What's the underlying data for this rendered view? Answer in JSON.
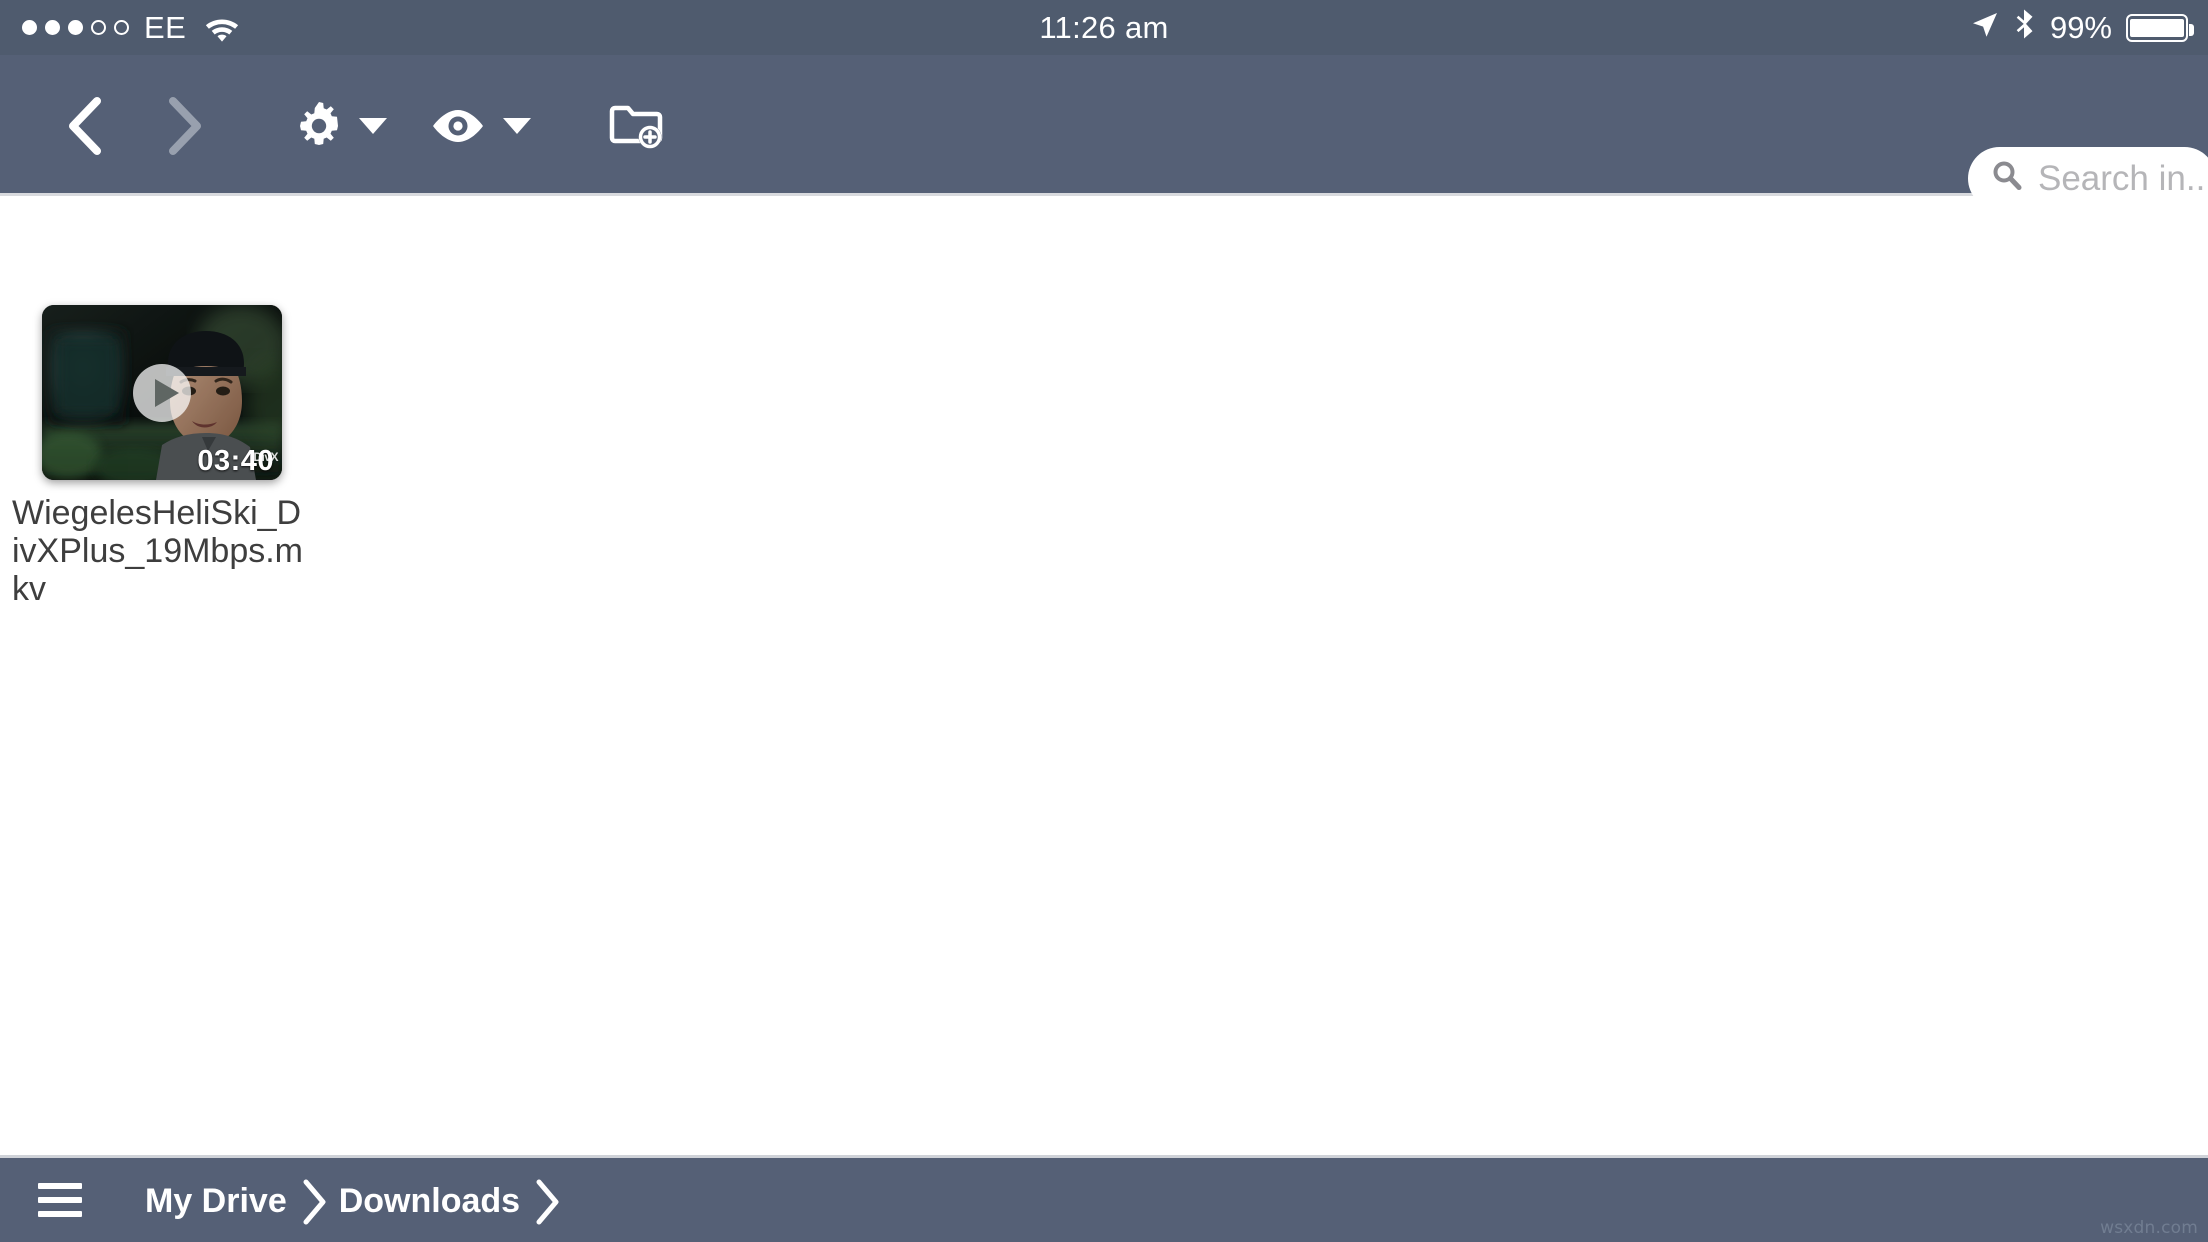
{
  "status_bar": {
    "signal_dots_filled": 3,
    "signal_dots_total": 5,
    "carrier": "EE",
    "wifi_icon": "wifi-icon",
    "time": "11:26 am",
    "location_icon": "location-arrow-icon",
    "bluetooth_icon": "bluetooth-icon",
    "battery_percent": "99%",
    "battery_level": 99
  },
  "toolbar": {
    "back_label": "‹",
    "forward_label": "›",
    "back_enabled": true,
    "forward_enabled": false,
    "settings_icon": "gear-icon",
    "view_icon": "eye-icon",
    "new_folder_icon": "new-folder-icon",
    "search": {
      "value": "",
      "placeholder": "Search in...",
      "icon": "search-icon"
    }
  },
  "content": {
    "files": [
      {
        "name": "WiegelesHeliSki_DivXPlus_19Mbps.mkv",
        "duration": "03:40",
        "type": "video",
        "badge": "DivX",
        "play_icon": "play-icon"
      }
    ]
  },
  "bottom_bar": {
    "menu_icon": "hamburger-menu-icon",
    "breadcrumbs": [
      {
        "label": "My Drive"
      },
      {
        "label": "Downloads"
      }
    ],
    "watermark": "wsxdn.com"
  },
  "colors": {
    "status_bar_bg": "#4f5b6e",
    "toolbar_bg": "#556076",
    "content_bg": "#ffffff",
    "text_light": "#ffffff",
    "filename_text": "#3e3e3e",
    "disabled_icon": "#98a0ae"
  }
}
